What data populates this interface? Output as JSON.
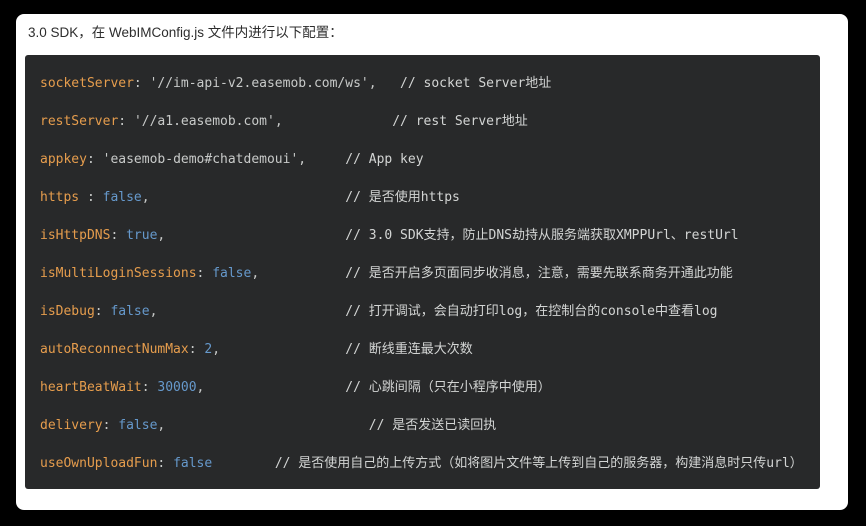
{
  "page": {
    "background": "#000000"
  },
  "card": {
    "background": "#ffffff"
  },
  "header": {
    "text": "3.0 SDK，在 WebIMConfig.js 文件内进行以下配置：",
    "color": "#2d2d2d"
  },
  "code": {
    "background": "#28292a",
    "colors": {
      "key": "#e69d4d",
      "string": "#c8cac9",
      "literal": "#6699cc",
      "comment": "#d3d5d4",
      "punctuation": "#c8cac9"
    },
    "lines": [
      {
        "key": "socketServer",
        "sep": ": ",
        "value": "'//im-api-v2.easemob.com/ws'",
        "type": "string",
        "comma": ",",
        "pad": 3,
        "comment": "// socket Server地址"
      },
      {
        "key": "restServer",
        "sep": ": ",
        "value": "'//a1.easemob.com'",
        "type": "string",
        "comma": ",",
        "pad": 14,
        "comment": "// rest Server地址"
      },
      {
        "key": "appkey",
        "sep": ": ",
        "value": "'easemob-demo#chatdemoui'",
        "type": "string",
        "comma": ",",
        "pad": 5,
        "comment": "// App key"
      },
      {
        "key": "https",
        "sep": " : ",
        "value": "false",
        "type": "literal",
        "comma": ",",
        "pad": 25,
        "comment": "// 是否使用https"
      },
      {
        "key": "isHttpDNS",
        "sep": ": ",
        "value": "true",
        "type": "literal",
        "comma": ",",
        "pad": 23,
        "comment": "// 3.0 SDK支持，防止DNS劫持从服务端获取XMPPUrl、restUrl"
      },
      {
        "key": "isMultiLoginSessions",
        "sep": ": ",
        "value": "false",
        "type": "literal",
        "comma": ",",
        "pad": 11,
        "comment": "// 是否开启多页面同步收消息，注意，需要先联系商务开通此功能"
      },
      {
        "key": "isDebug",
        "sep": ": ",
        "value": "false",
        "type": "literal",
        "comma": ",",
        "pad": 24,
        "comment": "// 打开调试，会自动打印log，在控制台的console中查看log"
      },
      {
        "key": "autoReconnectNumMax",
        "sep": ": ",
        "value": "2",
        "type": "literal",
        "comma": ",",
        "pad": 16,
        "comment": "// 断线重连最大次数"
      },
      {
        "key": "heartBeatWait",
        "sep": ": ",
        "value": "30000",
        "type": "literal",
        "comma": ",",
        "pad": 18,
        "comment": "// 心跳间隔（只在小程序中使用）"
      },
      {
        "key": "delivery",
        "sep": ": ",
        "value": "false",
        "type": "literal",
        "comma": ",",
        "pad": 26,
        "comment": "// 是否发送已读回执"
      },
      {
        "key": "useOwnUploadFun",
        "sep": ": ",
        "value": "false",
        "type": "literal",
        "comma": "",
        "pad": 8,
        "comment": "// 是否使用自己的上传方式（如将图片文件等上传到自己的服务器，构建消息时只传url）"
      }
    ]
  }
}
